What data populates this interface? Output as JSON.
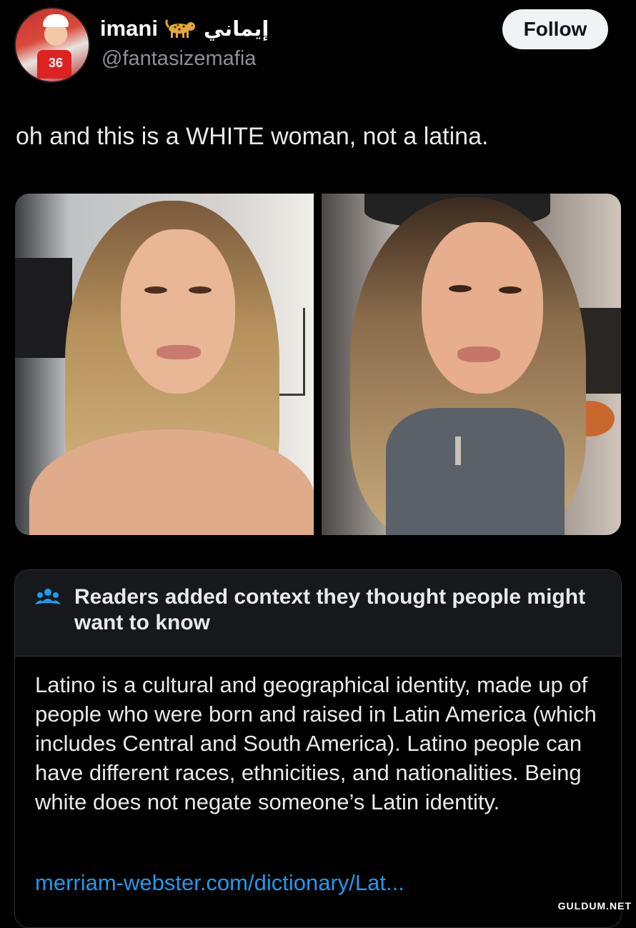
{
  "post": {
    "display_name": "imani",
    "name_emoji": "leopard-icon",
    "arabic_name": "إيماني",
    "handle": "@fantasizemafia",
    "follow_label": "Follow",
    "avatar_number": "36",
    "text": "oh and this is a WHITE woman, not a latina."
  },
  "media": [
    {
      "alt": "selfie photo left"
    },
    {
      "alt": "selfie photo right"
    }
  ],
  "note": {
    "icon": "people-icon",
    "title": "Readers added context they thought people might want to know",
    "body": "Latino is a cultural and geographical identity, made up of people who were born and raised in Latin America (which includes Central and South America). Latino people can have different races, ethnicities, and nationalities. Being white does not negate someone’s Latin identity.",
    "link": "merriam-webster.com/dictionary/Lat..."
  },
  "watermark": "GULDUM.NET",
  "colors": {
    "background": "#000000",
    "text": "#e7e9ea",
    "muted": "#8b9097",
    "link": "#1d9bf0",
    "note_header": "#16181c"
  }
}
